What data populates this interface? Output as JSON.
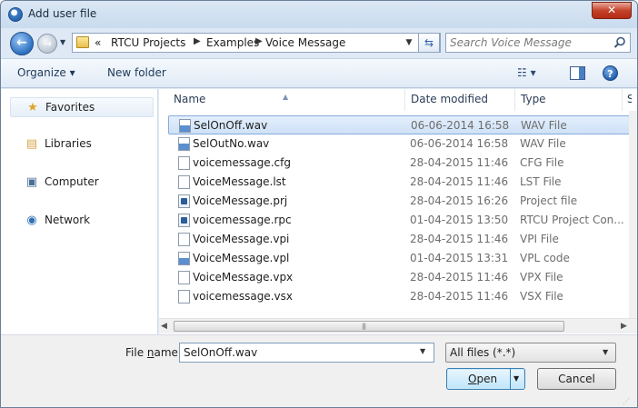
{
  "window": {
    "title": "Add user file",
    "close_label": "✕"
  },
  "address": {
    "overflow": "«",
    "crumbs": [
      "RTCU Projects",
      "Examples",
      "Voice Message"
    ]
  },
  "search": {
    "placeholder": "Search Voice Message"
  },
  "toolbar": {
    "organize_label": "Organize ▾",
    "newfolder_label": "New folder",
    "views_label": "☷ ▾",
    "help_label": "?"
  },
  "navpane": {
    "items": [
      {
        "label": "Favorites",
        "icon": "star-icon"
      },
      {
        "label": "Libraries",
        "icon": "libraries-icon"
      },
      {
        "label": "Computer",
        "icon": "computer-icon"
      },
      {
        "label": "Network",
        "icon": "network-icon"
      }
    ]
  },
  "filelist": {
    "columns": [
      "Name",
      "Date modified",
      "Type",
      "S"
    ],
    "selected_index": 0,
    "rows": [
      {
        "name": "SelOnOff.wav",
        "date": "06-06-2014 16:58",
        "type": "WAV File",
        "icon": "audio-file-icon"
      },
      {
        "name": "SelOutNo.wav",
        "date": "06-06-2014 16:58",
        "type": "WAV File",
        "icon": "audio-file-icon"
      },
      {
        "name": "voicemessage.cfg",
        "date": "28-04-2015 11:46",
        "type": "CFG File",
        "icon": "file-icon"
      },
      {
        "name": "VoiceMessage.lst",
        "date": "28-04-2015 11:46",
        "type": "LST File",
        "icon": "file-icon"
      },
      {
        "name": "VoiceMessage.prj",
        "date": "28-04-2015 16:26",
        "type": "Project file",
        "icon": "project-file-icon"
      },
      {
        "name": "voicemessage.rpc",
        "date": "01-04-2015 13:50",
        "type": "RTCU Project Con...",
        "icon": "rtcu-file-icon"
      },
      {
        "name": "VoiceMessage.vpi",
        "date": "28-04-2015 11:46",
        "type": "VPI File",
        "icon": "file-icon"
      },
      {
        "name": "VoiceMessage.vpl",
        "date": "01-04-2015 13:31",
        "type": "VPL code",
        "icon": "vpl-file-icon"
      },
      {
        "name": "VoiceMessage.vpx",
        "date": "28-04-2015 11:46",
        "type": "VPX File",
        "icon": "file-icon"
      },
      {
        "name": "voicemessage.vsx",
        "date": "28-04-2015 11:46",
        "type": "VSX File",
        "icon": "file-icon"
      }
    ]
  },
  "bottom": {
    "filename_label_pre": "File ",
    "filename_label_u": "n",
    "filename_label_post": "ame:",
    "filename_value": "SelOnOff.wav",
    "filter_value": "All files (*.*)",
    "open_label_u": "O",
    "open_label_rest": "pen",
    "cancel_label": "Cancel"
  }
}
